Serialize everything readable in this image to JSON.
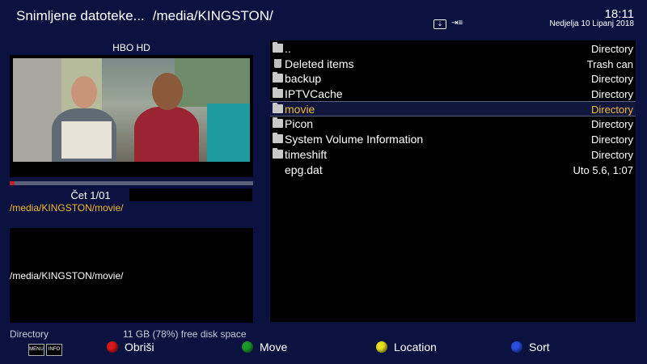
{
  "header": {
    "title": "Snimljene datoteke...",
    "path": "/media/KINGSTON/",
    "time": "18:11",
    "date": "Nedjelja 10 Lipanj 2018"
  },
  "preview": {
    "channel": "HBO HD",
    "progress": 0.02,
    "epg_time": "Čet  1/01",
    "current_path": "/media/KINGSTON/movie/"
  },
  "info": {
    "path": "/media/KINGSTON/movie/"
  },
  "list": {
    "items": [
      {
        "name": "..",
        "type": "Directory",
        "icon": "folder-icon"
      },
      {
        "name": "Deleted items",
        "type": "Trash can",
        "icon": "trash-icon"
      },
      {
        "name": "backup",
        "type": "Directory",
        "icon": "folder-icon"
      },
      {
        "name": "IPTVCache",
        "type": "Directory",
        "icon": "folder-icon"
      },
      {
        "name": "movie",
        "type": "Directory",
        "icon": "folder-icon",
        "selected": true
      },
      {
        "name": "Picon",
        "type": "Directory",
        "icon": "folder-icon"
      },
      {
        "name": "System Volume Information",
        "type": "Directory",
        "icon": "folder-icon"
      },
      {
        "name": "timeshift",
        "type": "Directory",
        "icon": "folder-icon"
      },
      {
        "name": "epg.dat",
        "type": "Uto 5.6, 1:07",
        "icon": ""
      }
    ]
  },
  "footer": {
    "selected_type": "Directory",
    "free_space": "11 GB (78%) free disk space",
    "menu_key": "MENU",
    "info_key": "INFO",
    "buttons": [
      {
        "label": "Obriši",
        "color": "#d81818"
      },
      {
        "label": "Move",
        "color": "#1c9a2a"
      },
      {
        "label": "Location",
        "color": "#e8e21c"
      },
      {
        "label": "Sort",
        "color": "#2a4ee0"
      }
    ]
  },
  "colors": {
    "background": "#0b1240",
    "highlight": "#f3b82c"
  }
}
